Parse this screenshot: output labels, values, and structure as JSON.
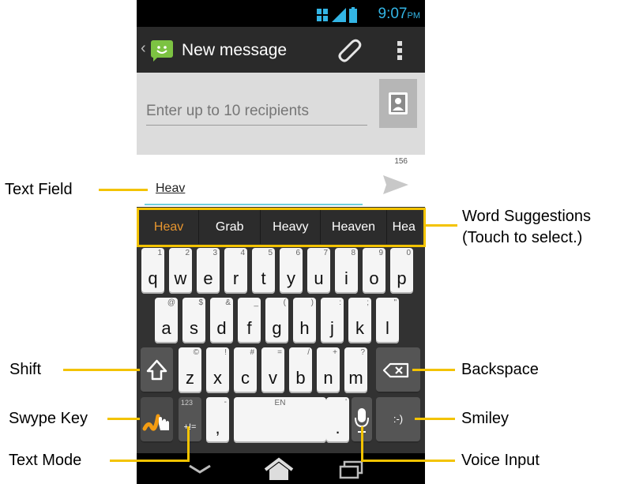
{
  "status": {
    "time": "9:07",
    "ampm": "PM"
  },
  "actionbar": {
    "back_glyph": "‹",
    "title": "New message"
  },
  "recipients": {
    "placeholder": "Enter up to 10 recipients"
  },
  "compose": {
    "char_count": "156",
    "text": "Heav"
  },
  "suggestions": [
    "Heav",
    "Grab",
    "Heavy",
    "Heaven",
    "Hea"
  ],
  "keys": {
    "row1": [
      {
        "l": "q",
        "h": "1"
      },
      {
        "l": "w",
        "h": "2"
      },
      {
        "l": "e",
        "h": "3"
      },
      {
        "l": "r",
        "h": "4"
      },
      {
        "l": "t",
        "h": "5"
      },
      {
        "l": "y",
        "h": "6"
      },
      {
        "l": "u",
        "h": "7"
      },
      {
        "l": "i",
        "h": "8"
      },
      {
        "l": "o",
        "h": "9"
      },
      {
        "l": "p",
        "h": "0"
      }
    ],
    "row2": [
      {
        "l": "a",
        "h": "@"
      },
      {
        "l": "s",
        "h": "$"
      },
      {
        "l": "d",
        "h": "&"
      },
      {
        "l": "f",
        "h": "_"
      },
      {
        "l": "g",
        "h": "("
      },
      {
        "l": "h",
        "h": ")"
      },
      {
        "l": "j",
        "h": ":"
      },
      {
        "l": "k",
        "h": ";"
      },
      {
        "l": "l",
        "h": "\""
      }
    ],
    "row3": [
      {
        "l": "z",
        "h": "©"
      },
      {
        "l": "x",
        "h": "!"
      },
      {
        "l": "c",
        "h": "#"
      },
      {
        "l": "v",
        "h": "="
      },
      {
        "l": "b",
        "h": "/"
      },
      {
        "l": "n",
        "h": "+"
      },
      {
        "l": "m",
        "h": "?"
      }
    ],
    "textmode_hint": "123",
    "textmode_label": "+!=",
    "comma_hint": "-",
    "comma": ",",
    "space_hint": "EN",
    "period_hint": "'",
    "period": ".",
    "smiley": ":-)"
  },
  "callouts": {
    "text_field": "Text Field",
    "word_suggestions_1": "Word Suggestions",
    "word_suggestions_2": "(Touch to select.)",
    "shift": "Shift",
    "backspace": "Backspace",
    "swype_key": "Swype Key",
    "smiley": "Smiley",
    "text_mode": "Text Mode",
    "voice_input": "Voice Input"
  },
  "colors": {
    "accent": "#f3c300",
    "suggest_active": "#e8962f",
    "status": "#33b5e5",
    "field_underline": "#6fd0dc"
  }
}
